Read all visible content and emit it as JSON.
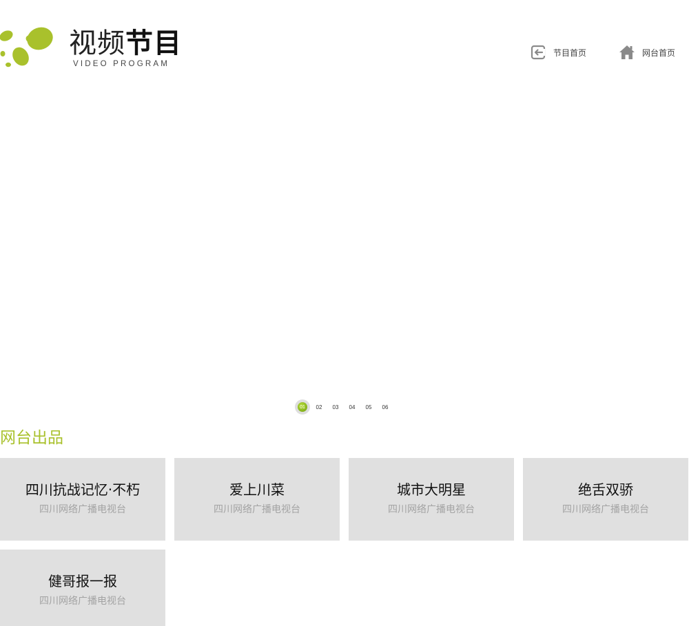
{
  "header": {
    "logo_title_light": "视频",
    "logo_title_bold": "节目",
    "logo_subtitle": "VIDEO PROGRAM",
    "nav": [
      {
        "label": "节目首页",
        "icon": "back-arrow-icon"
      },
      {
        "label": "网台首页",
        "icon": "home-icon"
      }
    ]
  },
  "colors": {
    "brand_green": "#a9c12c",
    "card_bg": "#e0e0e0",
    "pager_active": "#8dbb1c"
  },
  "banner": {
    "pager": [
      "01",
      "02",
      "03",
      "04",
      "05",
      "06"
    ],
    "active_index": 0
  },
  "section": {
    "title": "网台出品"
  },
  "programs": [
    {
      "title": "四川抗战记忆·不朽",
      "producer": "四川网络广播电视台"
    },
    {
      "title": "爱上川菜",
      "producer": "四川网络广播电视台"
    },
    {
      "title": "城市大明星",
      "producer": "四川网络广播电视台"
    },
    {
      "title": "绝舌双骄",
      "producer": "四川网络广播电视台"
    },
    {
      "title": "健哥报一报",
      "producer": "四川网络广播电视台"
    }
  ]
}
